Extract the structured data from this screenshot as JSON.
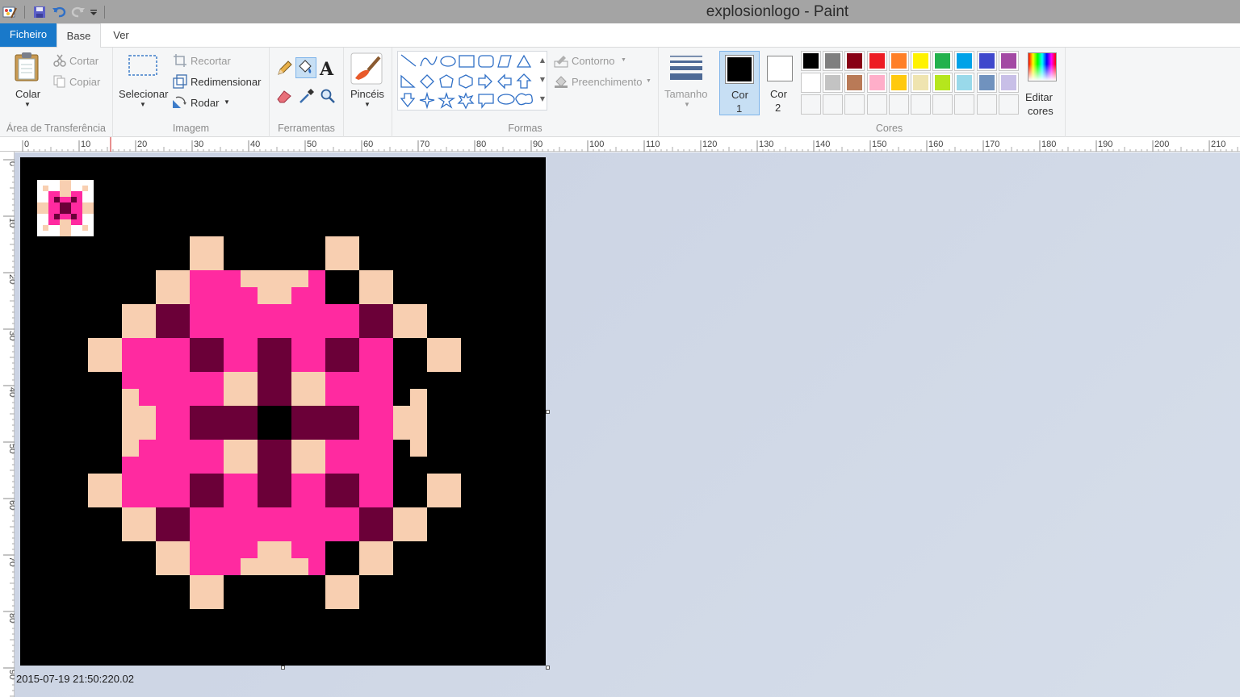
{
  "window": {
    "title": "explosionlogo - Paint"
  },
  "tabs": {
    "file": "Ficheiro",
    "home": "Base",
    "view": "Ver"
  },
  "clipboard": {
    "paste": "Colar",
    "cut": "Cortar",
    "copy": "Copiar",
    "label": "Área de Transferência"
  },
  "image": {
    "select": "Selecionar",
    "crop": "Recortar",
    "resize": "Redimensionar",
    "rotate": "Rodar",
    "label": "Imagem"
  },
  "tools": {
    "label": "Ferramentas"
  },
  "brushes": {
    "label": "Pincéis"
  },
  "shapes": {
    "outline": "Contorno",
    "fill": "Preenchimento",
    "label": "Formas"
  },
  "size": {
    "label": "Tamanho"
  },
  "colors": {
    "color1_label": "Cor\n1",
    "color1_line1": "Cor",
    "color1_line2": "1",
    "color2_line1": "Cor",
    "color2_line2": "2",
    "edit_line1": "Editar",
    "edit_line2": "cores",
    "label": "Cores",
    "color1": "#000000",
    "color2": "#ffffff",
    "palette_row1": [
      "#000000",
      "#7f7f7f",
      "#880015",
      "#ed1c24",
      "#ff7f27",
      "#fff200",
      "#22b14c",
      "#00a2e8",
      "#3f48cc",
      "#a349a4"
    ],
    "palette_row2": [
      "#ffffff",
      "#c3c3c3",
      "#b97a57",
      "#ffaec9",
      "#ffc90e",
      "#efe4b0",
      "#b5e61d",
      "#99d9ea",
      "#7092be",
      "#c8bfe7"
    ]
  },
  "ruler": {
    "top_ticks": [
      "0",
      "10",
      "20",
      "30",
      "40",
      "50",
      "60",
      "70",
      "80",
      "90",
      "100",
      "110",
      "120",
      "130",
      "140",
      "150",
      "160",
      "170",
      "180",
      "190",
      "200",
      "210"
    ],
    "left_ticks": [
      "0",
      "10",
      "20",
      "30",
      "40",
      "50",
      "60",
      "70",
      "80",
      "90"
    ]
  },
  "status": {
    "text": "2015-07-19 21:50:220.02"
  },
  "pixel_art": {
    "palette": {
      "K": "#000000",
      "P": "#ff2aa0",
      "D": "#6b0038",
      "B": "#f8cfb1",
      "W": "#ffffff"
    },
    "rows": [
      "KKKKKKKKKKKKKKKKKKKKKKKKKKKKKKK",
      "KKKKKKKKKKKKKKKKKKKKKKKKKKKKKKK",
      "KKKKKKKKKKKKKKKKKKKKKKKKKKKKKKK",
      "KKKKKKKKKKKKKKKKKKKKKKKKKKKKKKK",
      "KKKKKKKKKKKKKKKKKKKKKKKKKKKKKKK",
      "KKKKKBKKKBKKKKKKKKKKKKKKKKKKKKK",
      "KKKKBPBPPBKKKKKKKKKKKKKKKKKKKKK",
      "KKKBDPPPDBKKKKKKKKKKKKKKKKKKKKK",
      "KKBPDPDPDPBKKKKKKKKKKKKKKKKKKKK",
      "KKBPPBDBPPBKKKKKKKKKKKKKKKKKKKK"
    ]
  }
}
